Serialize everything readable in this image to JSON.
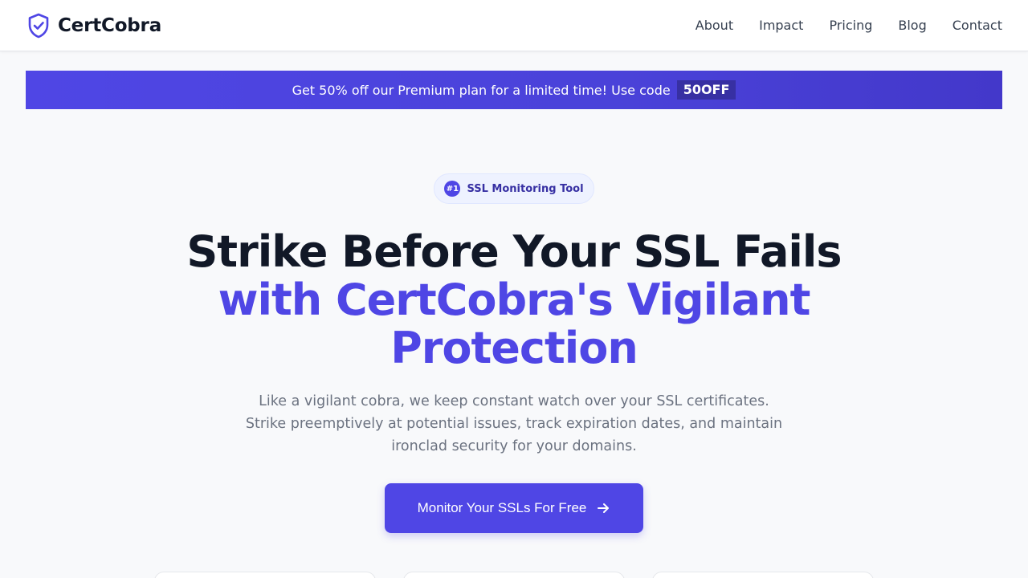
{
  "header": {
    "brand": "CertCobra",
    "brand_icon": "shield-check-icon",
    "nav": [
      "About",
      "Impact",
      "Pricing",
      "Blog",
      "Contact"
    ]
  },
  "promo": {
    "text": "Get 50% off our Premium plan for a limited time! Use code",
    "code": "50OFF"
  },
  "hero": {
    "badge_number": "#1",
    "badge_label": "SSL Monitoring Tool",
    "headline_line1": "Strike Before Your SSL Fails",
    "headline_line2": "with CertCobra's Vigilant Protection",
    "description": "Like a vigilant cobra, we keep constant watch over your SSL certificates. Strike preemptively at potential issues, track expiration dates, and maintain ironclad security for your domains.",
    "cta_label": "Monitor Your SSLs For Free",
    "cta_icon": "arrow-right-icon"
  },
  "colors": {
    "accent": "#4f46e5",
    "text_dark": "#111827",
    "text_muted": "#6b7280",
    "background": "#f8f9fb"
  }
}
